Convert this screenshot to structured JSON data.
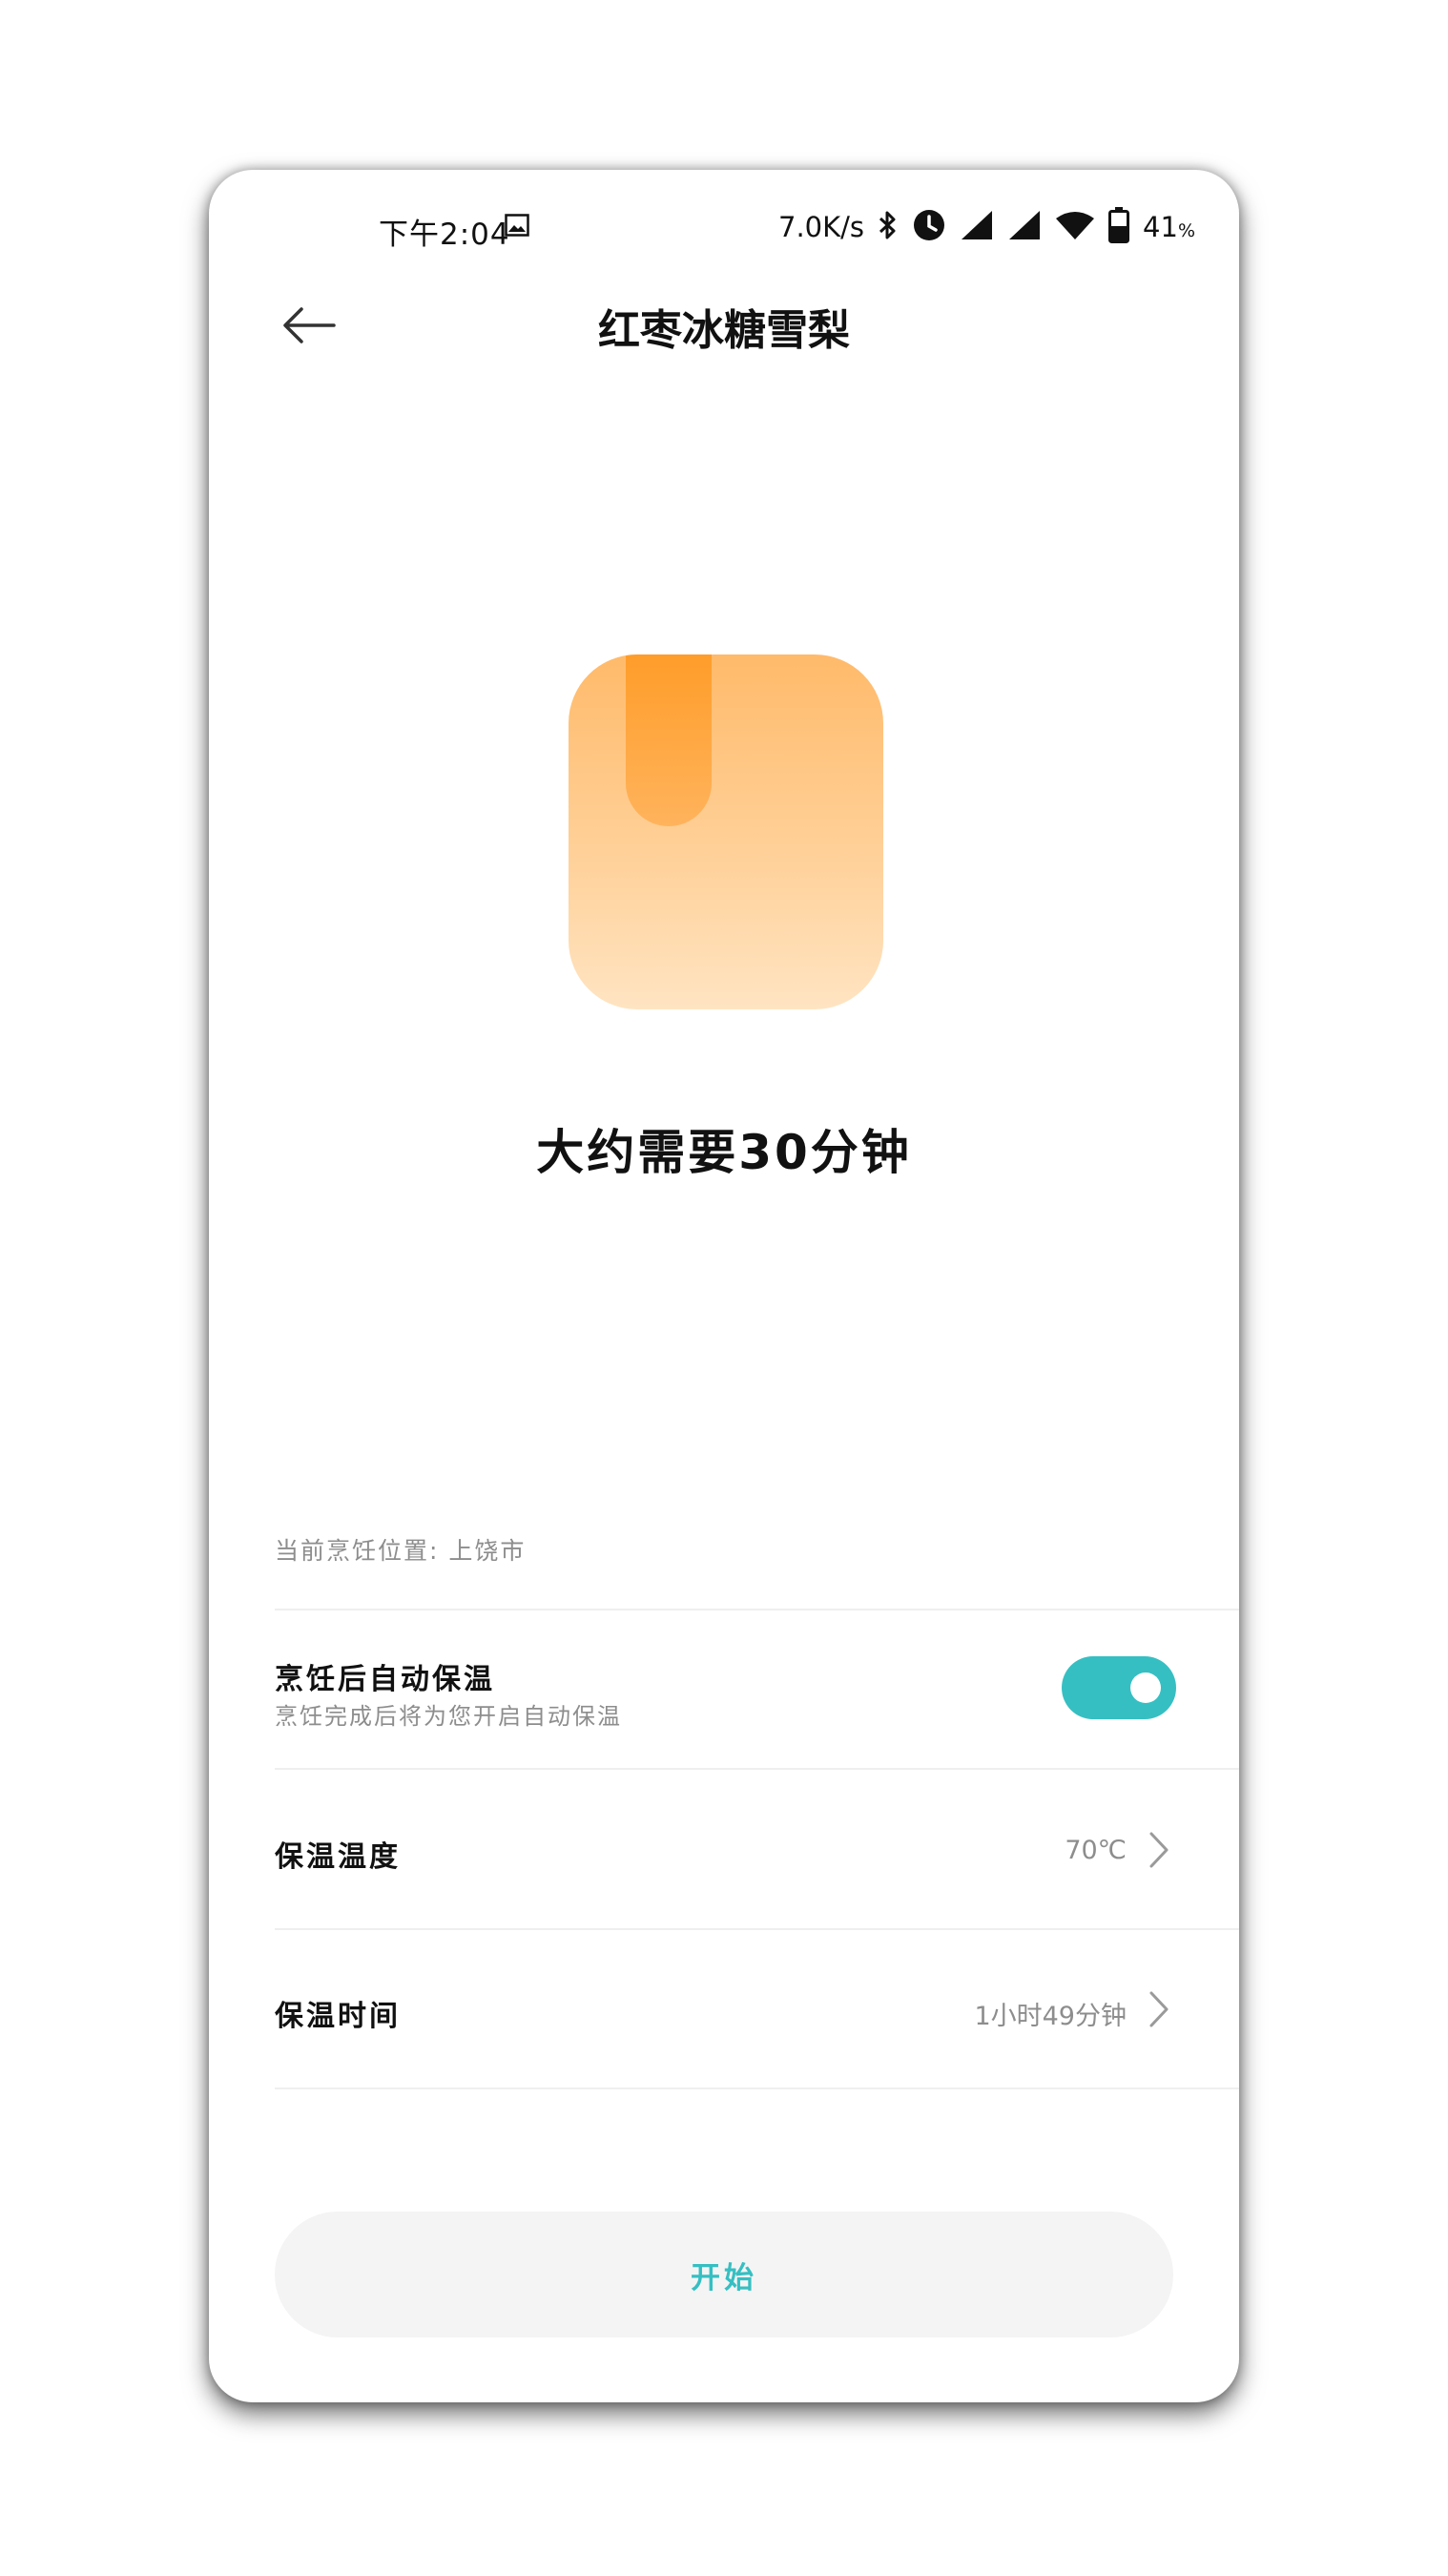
{
  "status_bar": {
    "time": "下午2:04",
    "net_speed": "7.0K/s",
    "battery_level": "41",
    "battery_unit": "%",
    "icons": [
      "image-icon",
      "bluetooth-icon",
      "alarm-icon",
      "signal-icon",
      "signal-icon",
      "wifi-icon",
      "battery-icon"
    ]
  },
  "header": {
    "back_icon": "back-arrow-icon",
    "title": "红枣冰糖雪梨"
  },
  "hero": {
    "icon": "recipe-book-icon",
    "icon_colors": [
      "#ff9d2a",
      "#ffba6a",
      "#ffe4c2"
    ],
    "duration_text": "大约需要30分钟"
  },
  "location": {
    "text": "当前烹饪位置: 上饶市"
  },
  "settings": {
    "keep_warm": {
      "title": "烹饪后自动保温",
      "subtitle": "烹饪完成后将为您开启自动保温",
      "enabled": true
    },
    "temperature": {
      "title": "保温温度",
      "value": "70℃"
    },
    "duration": {
      "title": "保温时间",
      "value": "1小时49分钟"
    }
  },
  "actions": {
    "start_label": "开始"
  },
  "colors": {
    "accent": "#36bfc2",
    "button_bg": "#f4f4f4",
    "secondary_text": "#8d8d8d"
  }
}
